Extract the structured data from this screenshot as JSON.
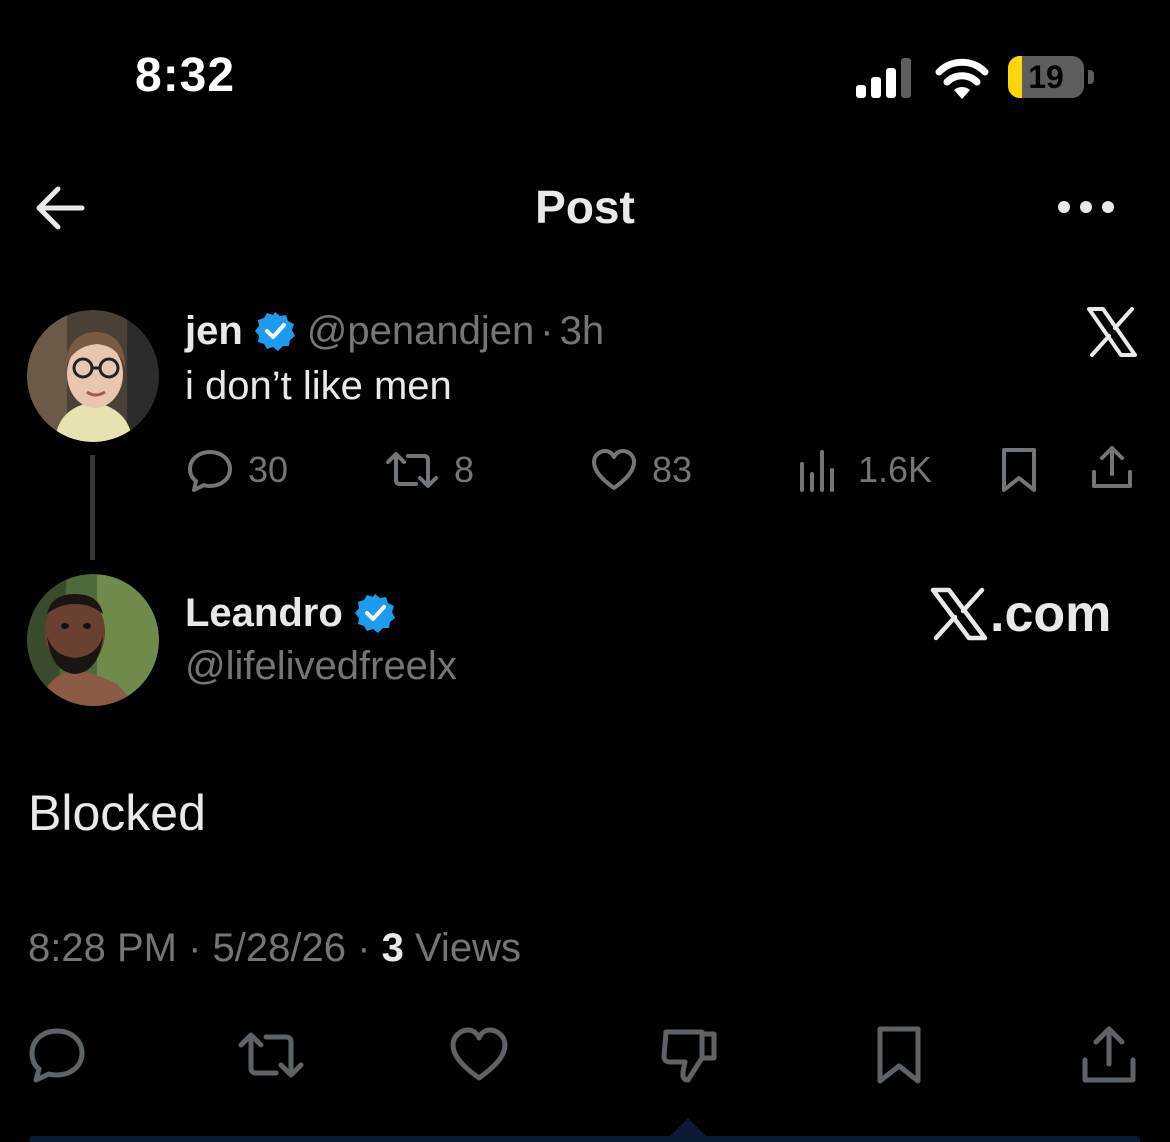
{
  "status_bar": {
    "time": "8:32",
    "battery": "19",
    "battery_color": "#ffd60a"
  },
  "header": {
    "title": "Post",
    "back_icon": "arrow-left-icon",
    "more_icon": "more-horizontal-icon"
  },
  "tweet_parent": {
    "name": "jen",
    "handle": "@penandjen",
    "separator": "·",
    "age": "3h",
    "text": "i don’t like men",
    "actions": {
      "replies": "30",
      "reposts": "8",
      "likes": "83",
      "views": "1.6K"
    }
  },
  "tweet_main": {
    "name": "Leandro",
    "handle": "@lifelivedfreelx",
    "brand": ".com",
    "text": "Blocked",
    "time": "8:28 PM",
    "date": "5/28/26",
    "dot": "·",
    "views_count": "3",
    "views_label": "Views"
  },
  "colors": {
    "background": "#000000",
    "text": "#e7e9ea",
    "muted": "#71767b",
    "verified": "#1d9bf0",
    "thread_line": "#333639"
  }
}
